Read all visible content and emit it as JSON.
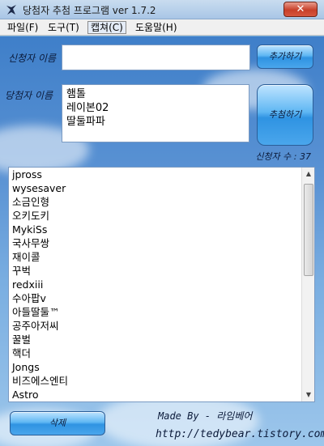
{
  "window": {
    "title": "당첨자 추첨 프로그램 ver 1.7.2",
    "close_glyph": "✕"
  },
  "menu": {
    "items": [
      "파일(F)",
      "도구(T)",
      "캡쳐(C)",
      "도움말(H)"
    ]
  },
  "form": {
    "applicant_label": "신청자 이름",
    "applicant_value": "",
    "add_button": "추가하기",
    "winner_label": "당첨자 이름",
    "winners": [
      "햄톨",
      "레이본02",
      "딸둘파파"
    ],
    "draw_button": "추첨하기",
    "count_label": "신청자 수 : 37"
  },
  "applicants": [
    "jpross",
    "wysesaver",
    "소금인형",
    "오키도키",
    "MykiSs",
    "국사무쌍",
    "재이콜",
    "꾸벅",
    "redxiii",
    "수아팝v",
    "아들딸둘™",
    "공주아저씨",
    "꿀벌",
    "핵더",
    "Jongs",
    "비즈에스엔티",
    "Astro"
  ],
  "footer": {
    "delete_button": "삭제",
    "made_by": "Made By - 라임베어",
    "url": "http://tedybear.tistory.com"
  },
  "icons": {
    "app": "bear-app-icon",
    "scroll_up": "scroll-up-arrow-icon",
    "scroll_down": "scroll-down-arrow-icon"
  }
}
